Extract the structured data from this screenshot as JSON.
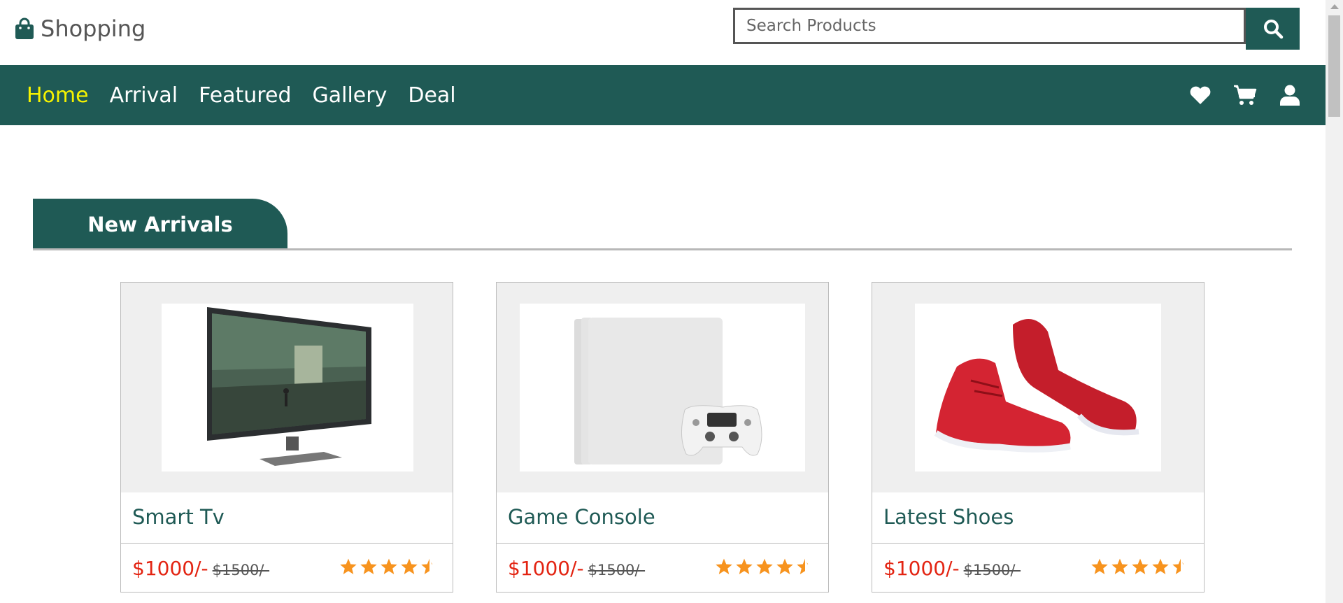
{
  "brand": {
    "name": "Shopping",
    "icon": "shopping-bag-icon"
  },
  "search": {
    "placeholder": "Search Products",
    "value": ""
  },
  "nav": {
    "links": [
      {
        "label": "Home",
        "active": true
      },
      {
        "label": "Arrival",
        "active": false
      },
      {
        "label": "Featured",
        "active": false
      },
      {
        "label": "Gallery",
        "active": false
      },
      {
        "label": "Deal",
        "active": false
      }
    ],
    "icons": [
      "heart-icon",
      "cart-icon",
      "user-icon"
    ]
  },
  "section": {
    "heading": "New Arrivals"
  },
  "products": [
    {
      "name": "Smart Tv",
      "price": "$1000/-",
      "old_price": "$1500/-",
      "rating": 4.5,
      "image": "smart-tv-image"
    },
    {
      "name": "Game Console",
      "price": "$1000/-",
      "old_price": "$1500/-",
      "rating": 4.5,
      "image": "game-console-image"
    },
    {
      "name": "Latest Shoes",
      "price": "$1000/-",
      "old_price": "$1500/-",
      "rating": 4.5,
      "image": "shoes-image"
    }
  ],
  "colors": {
    "primary": "#1f5a55",
    "active_nav": "#f6f300",
    "price": "#e32412",
    "star": "#f7931e"
  }
}
